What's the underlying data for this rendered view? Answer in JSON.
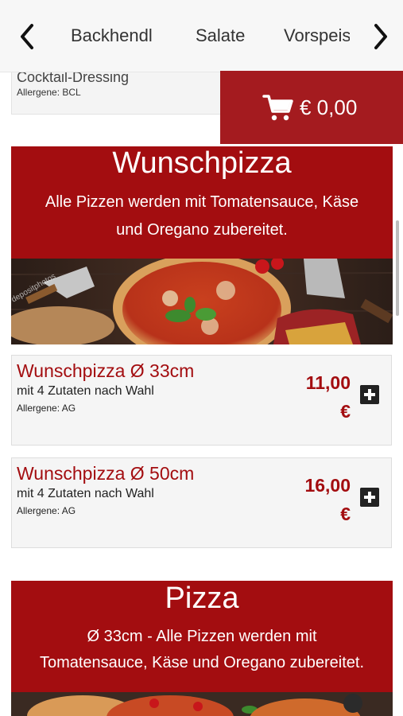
{
  "nav": {
    "categories": [
      "Backhendl",
      "Salate",
      "Vorspeisen"
    ],
    "back_icon": "chevron-left-icon",
    "forward_icon": "chevron-right-icon"
  },
  "cart": {
    "icon": "shopping-cart-icon",
    "total": "€ 0,00"
  },
  "previous_item": {
    "name": "Cocktail-Dressing",
    "allergens": "Allergene: BCL"
  },
  "sections": [
    {
      "title": "Wunschpizza",
      "description_lines": [
        "Alle Pizzen werden mit Tomatensauce, Käse",
        "und Oregano zubereitet."
      ],
      "watermark": "depositphotos",
      "items": [
        {
          "name": "Wunschpizza Ø 33cm",
          "description": "mit 4 Zutaten nach Wahl",
          "allergens": "Allergene: AG",
          "price": "11,00",
          "currency": "€",
          "add_icon": "plus-icon"
        },
        {
          "name": "Wunschpizza Ø 50cm",
          "description": "mit 4 Zutaten nach Wahl",
          "allergens": "Allergene: AG",
          "price": "16,00",
          "currency": "€",
          "add_icon": "plus-icon"
        }
      ]
    },
    {
      "title": "Pizza",
      "description_lines": [
        "Ø 33cm - Alle Pizzen werden mit",
        "Tomatensauce, Käse und Oregano zubereitet."
      ]
    }
  ],
  "colors": {
    "brand_red": "#a30d10",
    "cart_red": "#a41b1f",
    "card_bg": "#f5f5f5"
  }
}
